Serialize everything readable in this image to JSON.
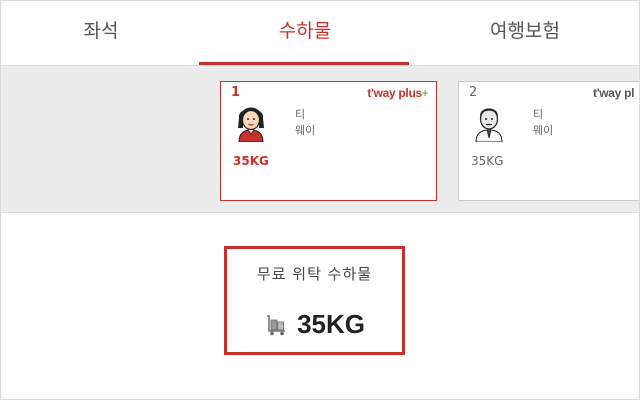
{
  "tabs": [
    {
      "label": "좌석",
      "active": false
    },
    {
      "label": "수하물",
      "active": true
    },
    {
      "label": "여행보험",
      "active": false
    }
  ],
  "passengers": [
    {
      "number": "1",
      "brand": "t'way plus",
      "brand_sup": "+",
      "first_name": "티",
      "last_name": "웨이",
      "baggage": "35KG",
      "selected": true,
      "avatar": "female-avatar-icon"
    },
    {
      "number": "2",
      "brand": "t'way pl",
      "brand_sup": "",
      "first_name": "티",
      "last_name": "웨이",
      "baggage": "35KG",
      "selected": false,
      "avatar": "male-avatar-icon"
    }
  ],
  "baggage_info": {
    "label": "무료 위탁 수하물",
    "weight": "35KG",
    "icon": "luggage-cart-icon"
  },
  "colors": {
    "accent": "#c9302c",
    "strip_bg": "#ececec",
    "brand_plus": "#7cb342"
  }
}
